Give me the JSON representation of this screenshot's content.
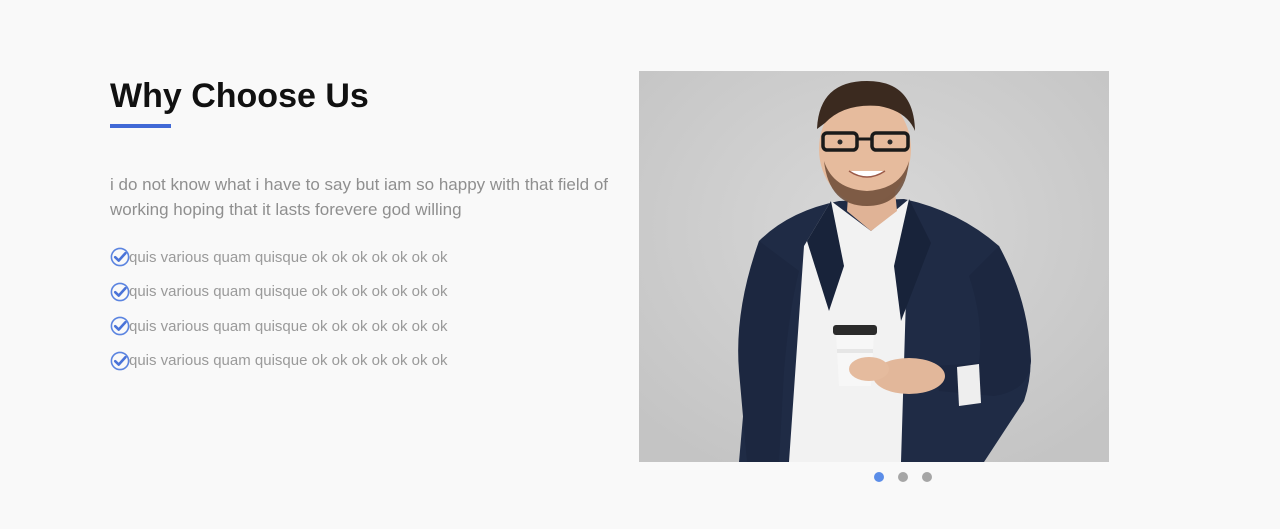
{
  "section": {
    "title": "Why Choose Us",
    "intro": "i do not know what i have to say but iam so happy with that field of working hoping that it lasts forevere god willing",
    "features": [
      "quis various quam quisque ok ok ok ok ok ok ok",
      "quis various quam quisque ok ok ok ok ok ok ok",
      "quis various quam quisque ok ok ok ok ok ok ok",
      "quis various quam quisque ok ok ok ok ok ok ok"
    ],
    "feature_icon": "check-circle-icon"
  },
  "carousel": {
    "image": "businessman-holding-coffee-photo",
    "slide_count": 3,
    "active_slide": 1
  },
  "colors": {
    "accent": "#4169d6",
    "dot_active": "#5b8de8",
    "dot_inactive": "#a6a6a6"
  }
}
